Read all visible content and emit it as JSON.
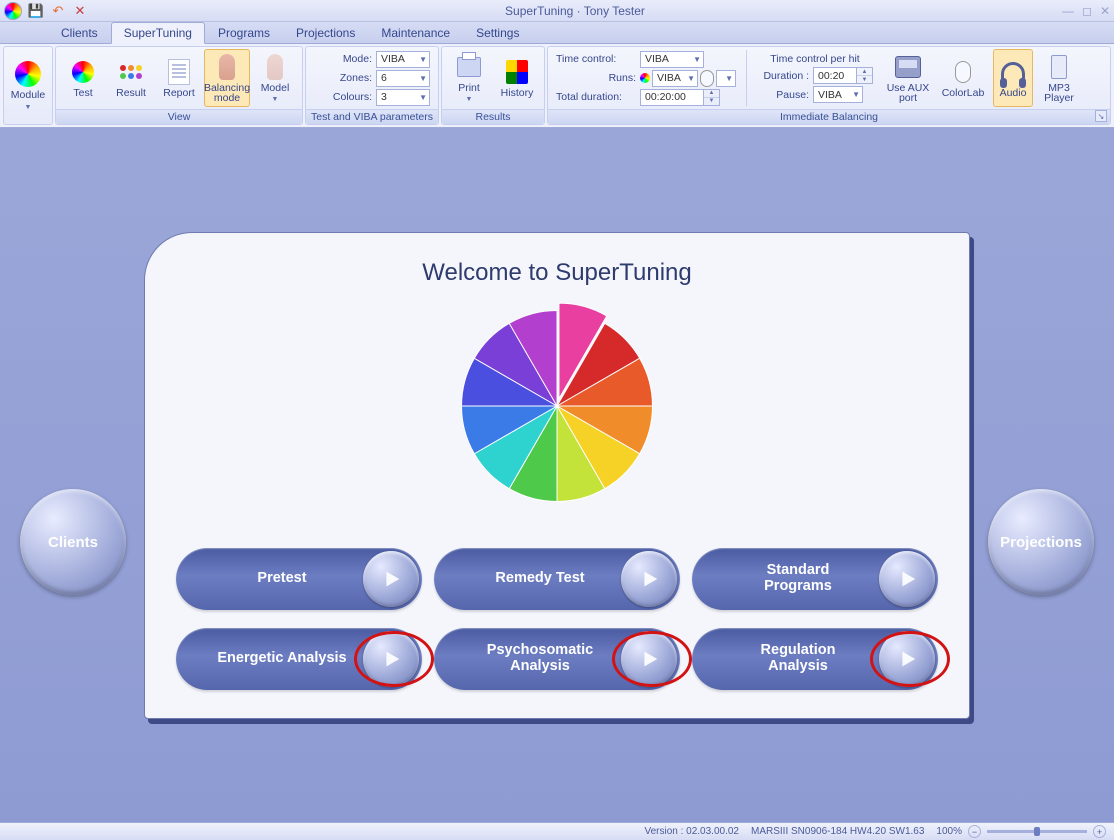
{
  "title": "SuperTuning · Tony Tester",
  "qat": {
    "save": "💾",
    "undo": "↶",
    "close": "✕"
  },
  "tabs": [
    "Clients",
    "SuperTuning",
    "Programs",
    "Projections",
    "Maintenance",
    "Settings"
  ],
  "active_tab": 1,
  "ribbon": {
    "module": {
      "label": "Module"
    },
    "view": {
      "test": "Test",
      "result": "Result",
      "report": "Report",
      "balancing": "Balancing\nmode",
      "model": "Model",
      "title": "View"
    },
    "params": {
      "mode_l": "Mode:",
      "mode_v": "VIBA",
      "zones_l": "Zones:",
      "zones_v": "6",
      "colours_l": "Colours:",
      "colours_v": "3",
      "title": "Test and VIBA parameters"
    },
    "results": {
      "print": "Print",
      "history": "History",
      "title": "Results"
    },
    "immediate": {
      "time_l": "Time control:",
      "time_v": "VIBA",
      "runs_l": "Runs:",
      "runs_v": "VIBA",
      "total_l": "Total duration:",
      "total_v": "00:20:00",
      "perhit": "Time control per hit",
      "dur_l": "Duration :",
      "dur_v": "00:20",
      "pause_l": "Pause:",
      "pause_v": "VIBA",
      "aux": "Use AUX\nport",
      "colorlab": "ColorLab",
      "audio": "Audio",
      "mp3": "MP3\nPlayer",
      "title": "Immediate Balancing"
    }
  },
  "welcome": {
    "heading": "Welcome to SuperTuning",
    "side_left": "Clients",
    "side_right": "Projections",
    "pills": [
      "Pretest",
      "Remedy Test",
      "Standard\nPrograms",
      "Energetic Analysis",
      "Psychosomatic\nAnalysis",
      "Regulation\nAnalysis"
    ]
  },
  "status": {
    "version": "Version : 02.03.00.02",
    "device": "MARSIII SN0906-184 HW4.20 SW1.63",
    "zoom": "100%"
  },
  "chart_data": {
    "type": "pie",
    "title": "Color wheel (decorative 12-segment hue wheel)",
    "categories": [
      "Magenta",
      "Red",
      "Red-Orange",
      "Orange",
      "Yellow",
      "Yellow-Green",
      "Green",
      "Cyan",
      "Blue",
      "Indigo",
      "Violet",
      "Purple"
    ],
    "values": [
      1,
      1,
      1,
      1,
      1,
      1,
      1,
      1,
      1,
      1,
      1,
      1
    ],
    "colors": [
      "#e83fa0",
      "#d62a2a",
      "#e85a2a",
      "#f08c2a",
      "#f5d225",
      "#c3e23a",
      "#4fc94a",
      "#2ed2cf",
      "#3a7be8",
      "#4a4fe0",
      "#7a3fd6",
      "#b33fcf"
    ]
  }
}
